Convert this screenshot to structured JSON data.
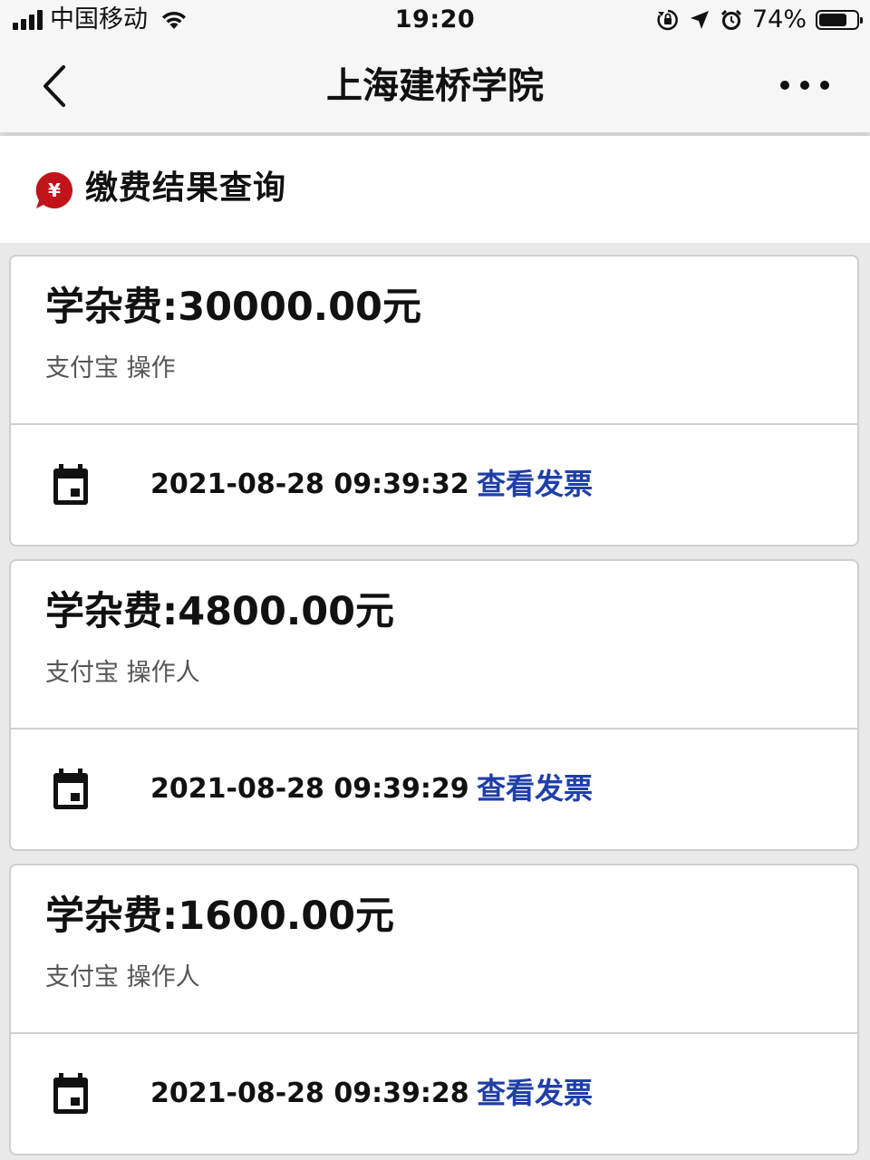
{
  "status_bar": {
    "carrier": "中国移动",
    "time": "19:20",
    "battery_percent": "74%",
    "battery_level": 0.74
  },
  "nav": {
    "title": "上海建桥学院",
    "back_icon": "chevron-left-icon",
    "more_icon": "more-horizontal-icon"
  },
  "section": {
    "title": "缴费结果查询",
    "icon": "yuan-icon",
    "icon_color": "#c0141a"
  },
  "records": [
    {
      "amount": "学杂费:30000.00元",
      "payer": "支付宝 操作",
      "datetime": "2021-08-28 09:39:32",
      "action": "查看发票"
    },
    {
      "amount": "学杂费:4800.00元",
      "payer": "支付宝 操作人",
      "datetime": "2021-08-28 09:39:29",
      "action": "查看发票"
    },
    {
      "amount": "学杂费:1600.00元",
      "payer": "支付宝 操作人",
      "datetime": "2021-08-28 09:39:28",
      "action": "查看发票"
    }
  ],
  "colors": {
    "link": "#1f3fa8",
    "page_background": "#e9e9e9"
  }
}
